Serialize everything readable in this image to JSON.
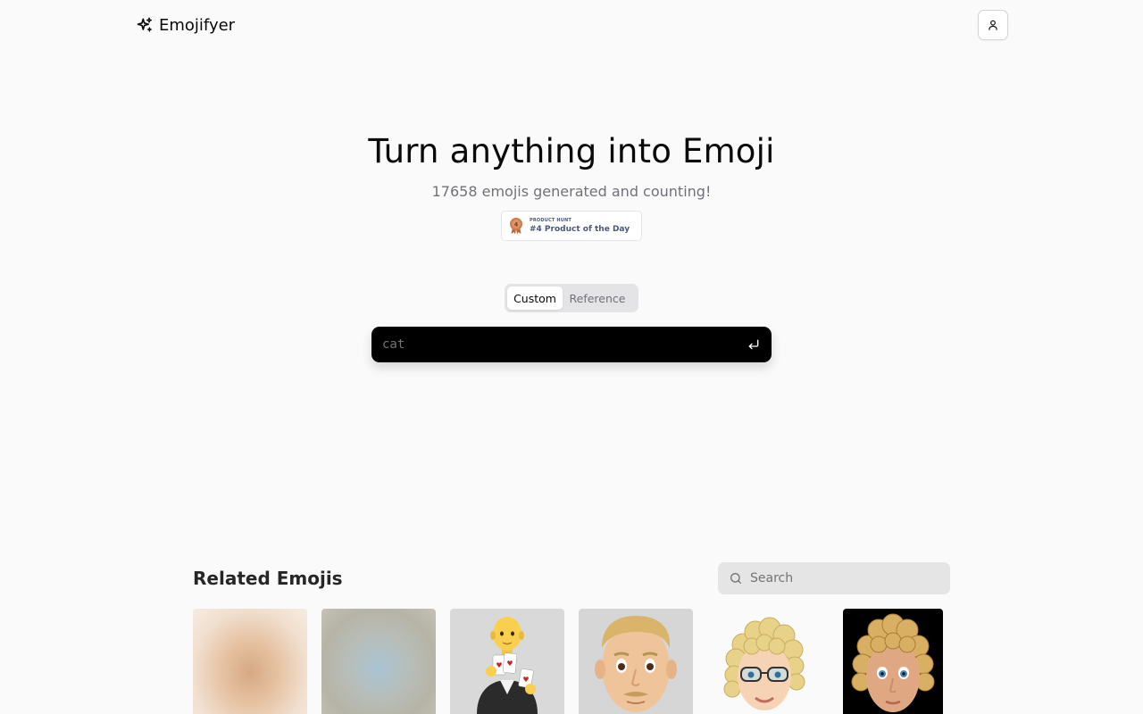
{
  "header": {
    "brand_name": "Emojifyer",
    "brand_icon": "sparkles-icon",
    "account_icon": "user-icon"
  },
  "hero": {
    "title": "Turn anything into Emoji",
    "subtitle": "17658 emojis generated and counting!",
    "badge": {
      "icon": "medal-icon",
      "small": "PRODUCT HUNT",
      "big": "#4 Product of the Day"
    }
  },
  "tabs": [
    {
      "label": "Custom",
      "active": true
    },
    {
      "label": "Reference",
      "active": false
    }
  ],
  "prompt": {
    "value": "",
    "placeholder": "cat",
    "submit_icon": "enter-icon"
  },
  "related": {
    "title": "Related Emojis",
    "search_placeholder": "Search",
    "search_icon": "search-icon",
    "items": [
      {
        "name": "blurred-emoji-1",
        "style": "blurred"
      },
      {
        "name": "blurred-emoji-2",
        "style": "blurred"
      },
      {
        "name": "judge-holding-cards-emoji",
        "style": "gray-bg"
      },
      {
        "name": "man-face-emoji",
        "style": "gray-bg"
      },
      {
        "name": "curly-hair-glasses-emoji",
        "style": "white-bg"
      },
      {
        "name": "curly-hair-face-emoji",
        "style": "black-bg"
      }
    ]
  },
  "colors": {
    "background": "#fafafa",
    "prompt_bg": "#000000",
    "subtitle": "#71717a",
    "badge_text": "#4b587c",
    "medal": "#cc7c4f"
  }
}
